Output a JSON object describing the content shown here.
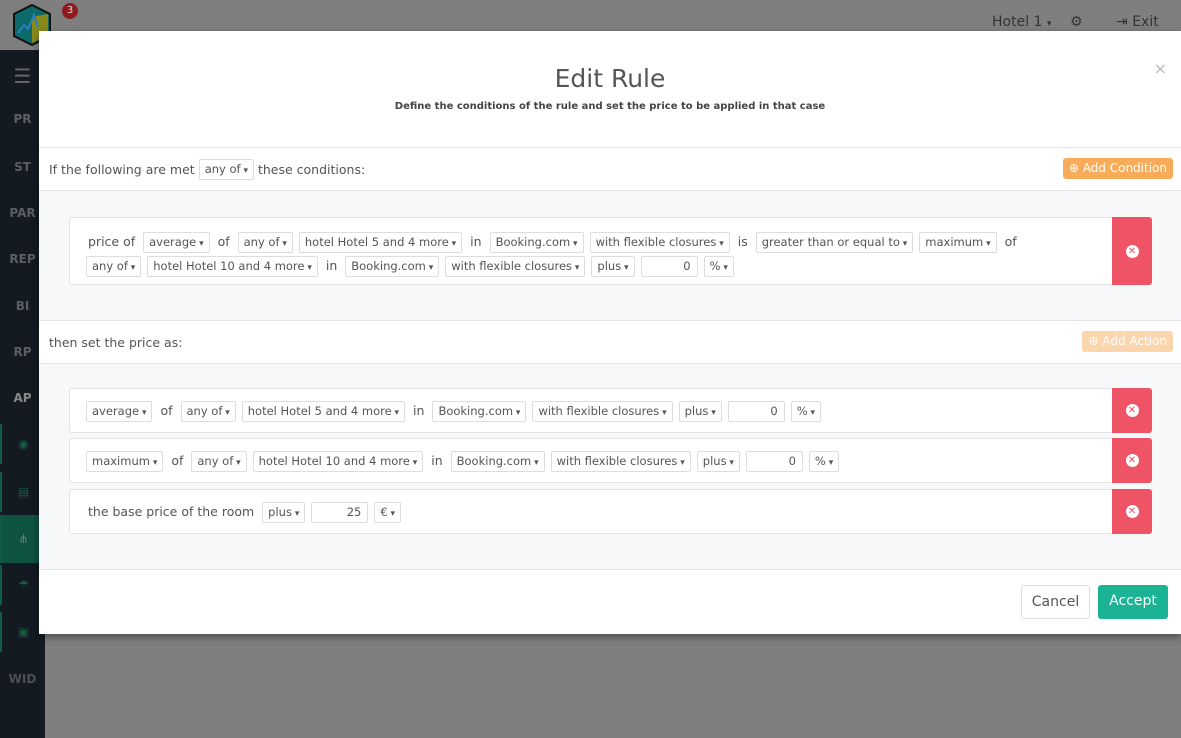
{
  "topbar": {
    "badge": "3",
    "hotel": "Hotel 1",
    "exit": "Exit"
  },
  "sidebar": {
    "items": [
      "PR",
      "ST",
      "PAR",
      "REP",
      "BI",
      "RP",
      "AP",
      "WID"
    ]
  },
  "modal": {
    "title": "Edit Rule",
    "subtitle": "Define the conditions of the rule and set the price to be applied in that case",
    "close": "×",
    "cond_prefix": "If the following are met",
    "cond_mode": "any of",
    "cond_suffix": "these conditions:",
    "add_condition": "Add Condition",
    "action_label": "then set the price as:",
    "add_action": "Add Action",
    "cancel": "Cancel",
    "accept": "Accept"
  },
  "conditions": [
    [
      {
        "t": "txt",
        "v": "price of"
      },
      {
        "t": "sel",
        "v": "average"
      },
      {
        "t": "txt",
        "v": "of"
      },
      {
        "t": "sel",
        "v": "any of"
      },
      {
        "t": "sel",
        "v": "hotel Hotel 5 and 4 more"
      },
      {
        "t": "txt",
        "v": "in"
      },
      {
        "t": "sel",
        "v": "Booking.com"
      },
      {
        "t": "sel",
        "v": "with flexible closures"
      },
      {
        "t": "txt",
        "v": "is"
      },
      {
        "t": "sel",
        "v": "greater than or equal to"
      },
      {
        "t": "sel",
        "v": "maximum"
      },
      {
        "t": "txt",
        "v": "of"
      },
      {
        "t": "sel",
        "v": "any of"
      },
      {
        "t": "sel",
        "v": "hotel Hotel 10 and 4 more"
      },
      {
        "t": "txt",
        "v": "in"
      },
      {
        "t": "sel",
        "v": "Booking.com"
      },
      {
        "t": "sel",
        "v": "with flexible closures"
      },
      {
        "t": "sel",
        "v": "plus"
      },
      {
        "t": "num",
        "v": "0"
      },
      {
        "t": "sel",
        "v": "%"
      }
    ]
  ],
  "actions": [
    [
      {
        "t": "sel",
        "v": "average"
      },
      {
        "t": "txt",
        "v": "of"
      },
      {
        "t": "sel",
        "v": "any of"
      },
      {
        "t": "sel",
        "v": "hotel Hotel 5 and 4 more"
      },
      {
        "t": "txt",
        "v": "in"
      },
      {
        "t": "sel",
        "v": "Booking.com"
      },
      {
        "t": "sel",
        "v": "with flexible closures"
      },
      {
        "t": "sel",
        "v": "plus"
      },
      {
        "t": "num",
        "v": "0"
      },
      {
        "t": "sel",
        "v": "%"
      }
    ],
    [
      {
        "t": "sel",
        "v": "maximum"
      },
      {
        "t": "txt",
        "v": "of"
      },
      {
        "t": "sel",
        "v": "any of"
      },
      {
        "t": "sel",
        "v": "hotel Hotel 10 and 4 more"
      },
      {
        "t": "txt",
        "v": "in"
      },
      {
        "t": "sel",
        "v": "Booking.com"
      },
      {
        "t": "sel",
        "v": "with flexible closures"
      },
      {
        "t": "sel",
        "v": "plus"
      },
      {
        "t": "num",
        "v": "0"
      },
      {
        "t": "sel",
        "v": "%"
      }
    ],
    [
      {
        "t": "txt",
        "v": "the base price of the room"
      },
      {
        "t": "sel",
        "v": "plus"
      },
      {
        "t": "num",
        "v": "25"
      },
      {
        "t": "sel",
        "v": "€"
      }
    ]
  ],
  "colors": {
    "accent": "#1ab394",
    "danger": "#ee5465",
    "warning": "#f8ac59"
  }
}
